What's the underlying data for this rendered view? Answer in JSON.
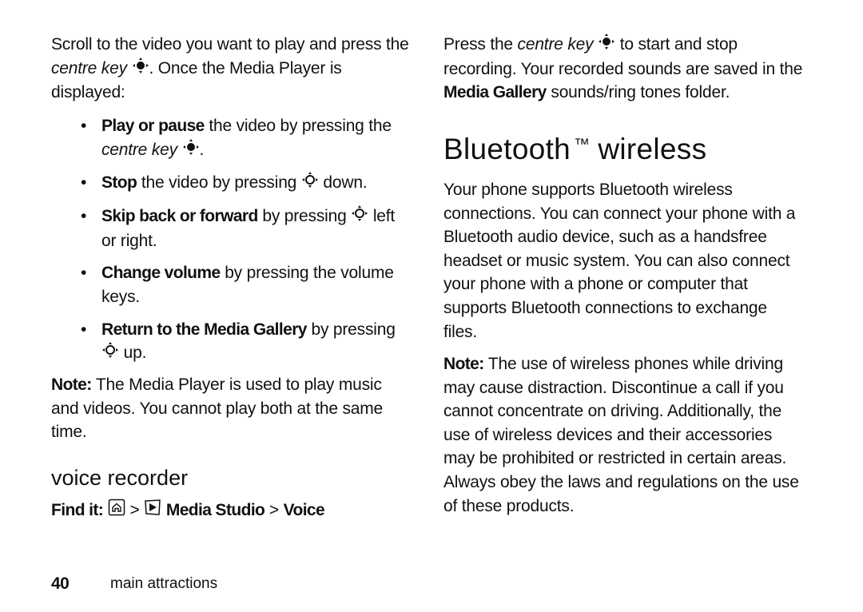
{
  "left_column": {
    "intro": {
      "part1": "Scroll to the video you want to play and press the ",
      "centre_key": "centre key",
      "part2": ". Once the Media Player is displayed:"
    },
    "bullets": [
      {
        "bold": "Play or pause",
        "text": " the video by pressing the ",
        "italic": "centre key",
        "after": ".",
        "icon": "centre-key-icon"
      },
      {
        "bold": "Stop",
        "text": " the video by pressing ",
        "after": " down.",
        "icon": "nav-key-icon"
      },
      {
        "bold": "Skip back or forward",
        "text": " by pressing ",
        "after": " left or right.",
        "icon": "nav-key-icon"
      },
      {
        "bold": "Change volume",
        "text": " by pressing the volume keys."
      },
      {
        "bold": "Return to the Media Gallery",
        "text": " by pressing ",
        "after": " up.",
        "icon": "nav-key-icon"
      }
    ],
    "note": {
      "label": "Note:",
      "text": " The Media Player is used to play music and videos. You cannot play both at the same time."
    },
    "section_title": "voice recorder",
    "find_it": {
      "label": "Find it:",
      "sep1": " > ",
      "item1": "Media Studio",
      "sep2": " > ",
      "item2": "Voice",
      "icons": [
        "home-key-icon",
        "media-studio-icon"
      ]
    }
  },
  "right_column": {
    "intro": {
      "part1": "Press the ",
      "centre_key": "centre key",
      "part2": " to start and stop recording. Your recorded sounds are saved in the ",
      "media_gallery": "Media Gallery",
      "part3": " sounds/ring tones folder."
    },
    "heading": "Bluetooth",
    "heading_tm": "™",
    "heading_rest": "wireless",
    "body": "Your phone supports Bluetooth wireless connections. You can connect your phone with a Bluetooth audio device, such as a handsfree headset or music system. You can also connect your phone with a phone or computer that supports Bluetooth connections to exchange files.",
    "note": {
      "label": "Note:",
      "text": " The use of wireless phones while driving may cause distraction. Discontinue a call if you cannot concentrate on driving. Additionally, the use of wireless devices and their accessories may be prohibited or restricted in certain areas. Always obey the laws and regulations on the use of these products."
    }
  },
  "footer": {
    "page_number": "40",
    "section": "main attractions"
  },
  "bullet_char": "•"
}
